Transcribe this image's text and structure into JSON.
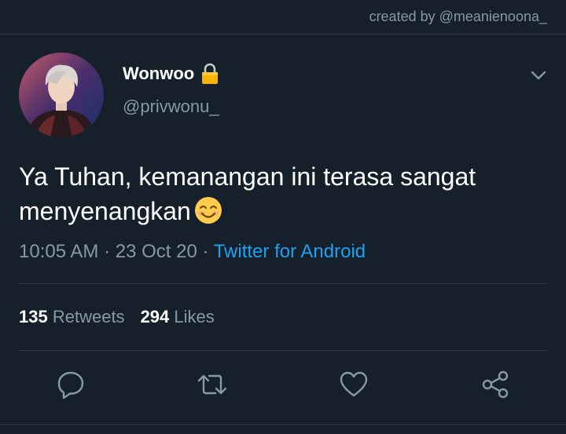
{
  "credit": "created by @meanienoona_",
  "tweet": {
    "author_name": "Wonwoo",
    "author_handle": "@privwonu_",
    "text": "Ya Tuhan, kemanangan ini terasa sangat menyenangkan",
    "time": "10:05 AM",
    "date": "23 Oct 20",
    "source": "Twitter for Android",
    "separator": "·"
  },
  "stats": {
    "retweets_count": "135",
    "retweets_label": "Retweets",
    "likes_count": "294",
    "likes_label": "Likes"
  },
  "icons": {
    "lock": "lock-icon",
    "chevron": "chevron-down-icon",
    "emoji": "smiling-face-emoji-icon",
    "reply": "reply-icon",
    "retweet": "retweet-icon",
    "like": "heart-icon",
    "share": "share-icon"
  },
  "colors": {
    "background": "#15202b",
    "secondary_text": "#8899a6",
    "link": "#1da1f2",
    "divider": "#2f3d4b"
  }
}
